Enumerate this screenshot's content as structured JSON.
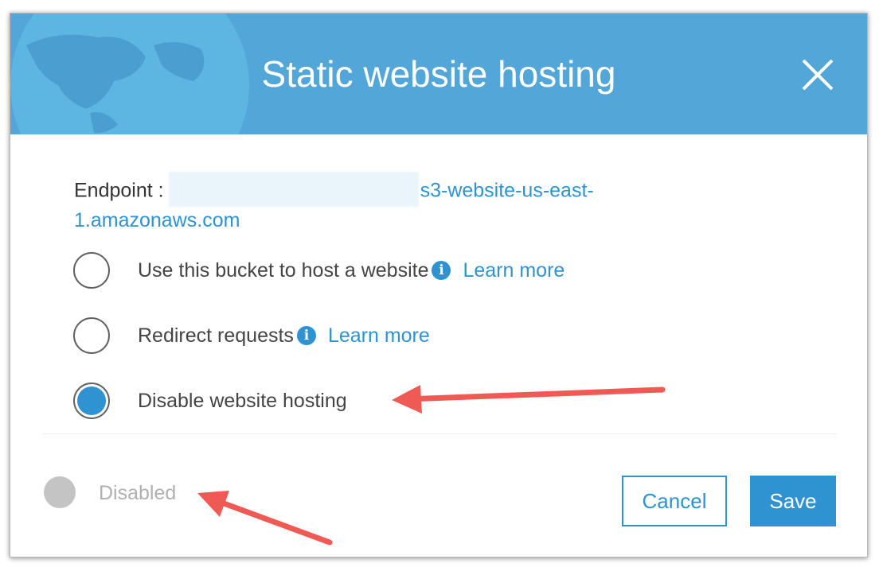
{
  "dialog": {
    "title": "Static website hosting",
    "close_icon": "close-icon"
  },
  "endpoint": {
    "label": "Endpoint :",
    "url_visible_part1": "s3-website-us-east-",
    "url_visible_part2": "1.amazonaws.com"
  },
  "options": [
    {
      "label": "Use this bucket to host a website",
      "info": "i",
      "learn_more": "Learn more",
      "selected": false
    },
    {
      "label": "Redirect requests",
      "info": "i",
      "learn_more": "Learn more",
      "selected": false
    },
    {
      "label": "Disable website hosting",
      "selected": true
    }
  ],
  "footer": {
    "status": "Disabled",
    "cancel_label": "Cancel",
    "save_label": "Save"
  },
  "colors": {
    "header": "#52a6d8",
    "accent": "#2e93d0",
    "arrow": "#f05a55"
  }
}
